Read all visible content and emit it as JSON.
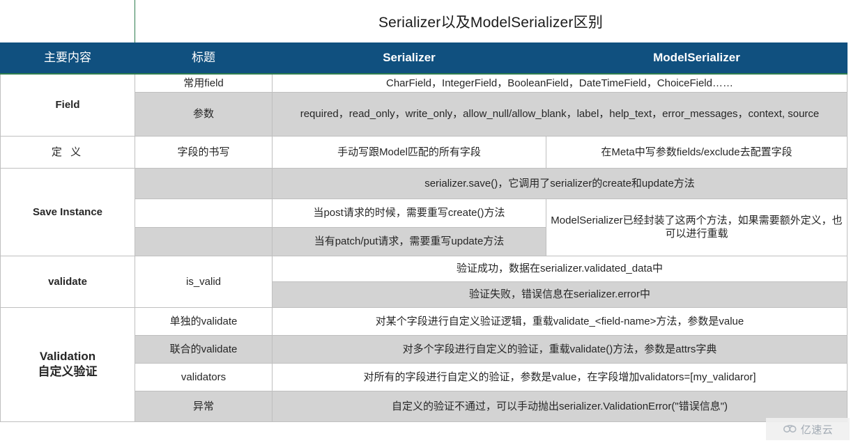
{
  "title": "Serializer以及ModelSerializer区别",
  "header": {
    "col_main": "主要内容",
    "col_sub": "标题",
    "col_serializer": "Serializer",
    "col_modelserializer": "ModelSerializer"
  },
  "categories": {
    "field": "Field",
    "definition": "定 义",
    "save_instance": "Save Instance",
    "validate": "validate",
    "validation_en": "Validation",
    "validation_cn": "自定义验证"
  },
  "rows": {
    "field_common_sub": "常用field",
    "field_common_value": "CharField，IntegerField，BooleanField，DateTimeField，ChoiceField……",
    "field_params_sub": "参数",
    "field_params_value": "required，read_only，write_only，allow_null/allow_blank，label，help_text，error_messages，context, source",
    "definition_sub": "字段的书写",
    "definition_serializer": "手动写跟Model匹配的所有字段",
    "definition_modelserializer": "在Meta中写参数fields/exclude去配置字段",
    "save_merged": "serializer.save()，它调用了serializer的create和update方法",
    "save_post": "当post请求的时候，需要重写create()方法",
    "save_patch": "当有patch/put请求，需要重写update方法",
    "save_modelserializer": "ModelSerializer已经封装了这两个方法，如果需要额外定义，也可以进行重载",
    "validate_sub": "is_valid",
    "validate_success": "验证成功，数据在serializer.validated_data中",
    "validate_fail": "验证失败，错误信息在serializer.error中",
    "validation_single_sub": "单独的validate",
    "validation_single_value": "对某个字段进行自定义验证逻辑，重载validate_<field-name>方法，参数是value",
    "validation_union_sub": "联合的validate",
    "validation_union_value": "对多个字段进行自定义的验证，重载validate()方法，参数是attrs字典",
    "validation_validators_sub": "validators",
    "validation_validators_value": "对所有的字段进行自定义的验证，参数是value，在字段增加validators=[my_validaror]",
    "validation_exception_sub": "异常",
    "validation_exception_value": "自定义的验证不通过，可以手动抛出serializer.ValidationError(\"错误信息\")"
  },
  "watermark": {
    "text": "亿速云",
    "icon": "cloud-icon"
  },
  "colors": {
    "header_bg": "#10507f",
    "header_rule": "#2e7d4f",
    "category_text": "#17558c",
    "shade": "#d3d3d3",
    "grid_line": "#bfbfbf"
  }
}
